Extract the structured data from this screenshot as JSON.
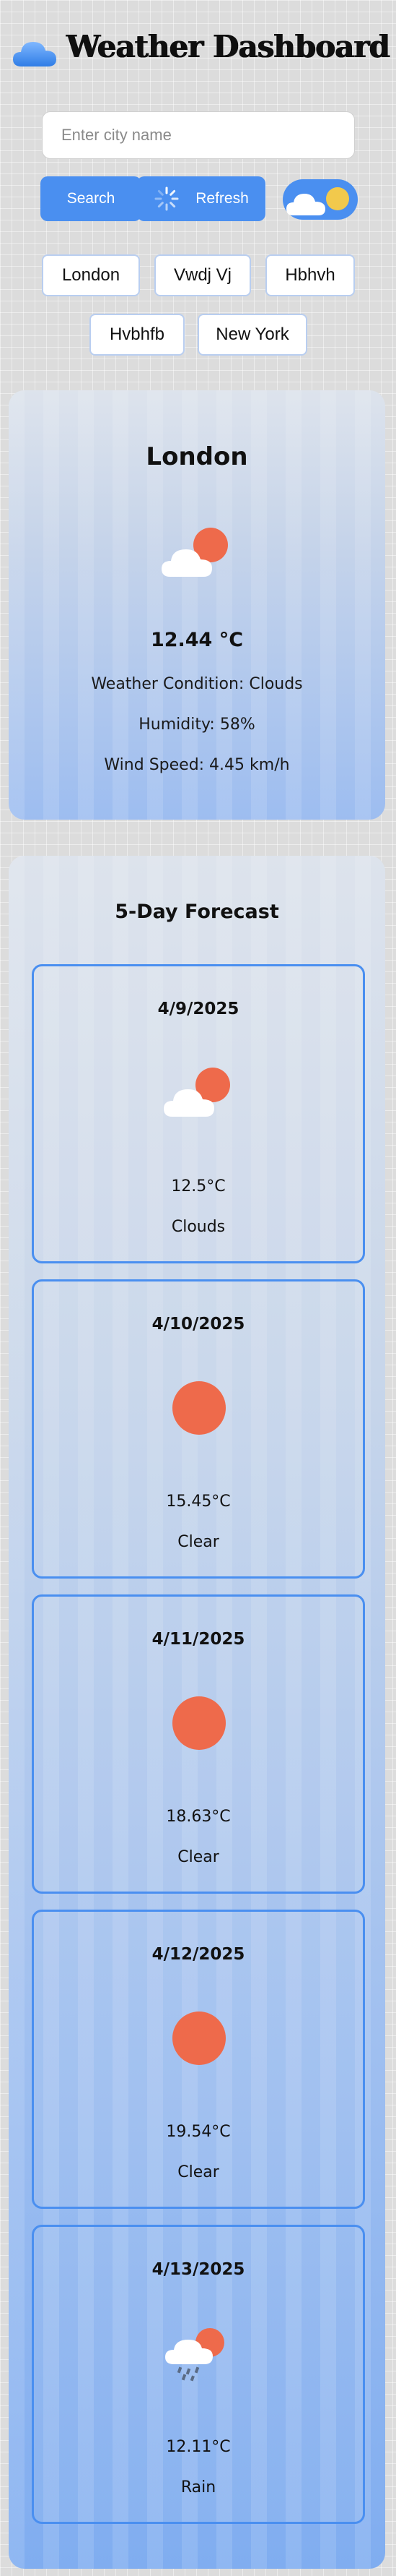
{
  "header": {
    "title": "Weather Dashboard",
    "logo_icon": "cloud-icon"
  },
  "search": {
    "placeholder": "Enter city name",
    "value": "",
    "search_label": "Search",
    "refresh_label": "Refresh"
  },
  "recent_cities": [
    "London",
    "Vwdj Vj",
    "Hbhvh",
    "Hvbhfb",
    "New York"
  ],
  "current": {
    "city": "London",
    "icon": "partly-cloudy-icon",
    "temperature": "12.44 °C",
    "condition": "Weather Condition: Clouds",
    "humidity": "Humidity: 58%",
    "wind": "Wind Speed: 4.45 km/h"
  },
  "forecast": {
    "title": "5-Day Forecast",
    "days": [
      {
        "date": "4/9/2025",
        "temp": "12.5°C",
        "condition": "Clouds",
        "icon": "partly-cloudy-icon"
      },
      {
        "date": "4/10/2025",
        "temp": "15.45°C",
        "condition": "Clear",
        "icon": "sun-icon"
      },
      {
        "date": "4/11/2025",
        "temp": "18.63°C",
        "condition": "Clear",
        "icon": "sun-icon"
      },
      {
        "date": "4/12/2025",
        "temp": "19.54°C",
        "condition": "Clear",
        "icon": "sun-icon"
      },
      {
        "date": "4/13/2025",
        "temp": "12.11°C",
        "condition": "Rain",
        "icon": "rain-icon"
      }
    ]
  },
  "colors": {
    "accent": "#4a8ff0",
    "sun": "#ee6a4b",
    "toggle_sun": "#f2c94c"
  }
}
